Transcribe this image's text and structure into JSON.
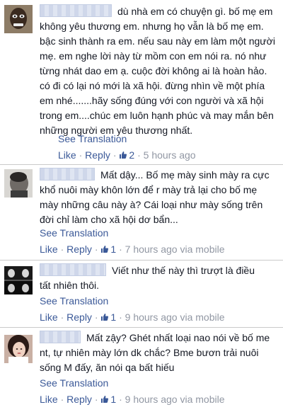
{
  "ui": {
    "see_translation": "See Translation",
    "like": "Like",
    "reply": "Reply",
    "dot": "·"
  },
  "comments": [
    {
      "text": "dù nhà em có chuyện gì. bố mẹ em không yêu thương em. nhưng họ vẫn là bố mẹ em. bậc sinh thành ra em. nếu sau này em làm một người mẹ. em nghe lời này từ mồm con em nói ra. nó như từng nhát dao em ạ. cuộc đời không ai là hoàn hảo. có đi có lại nó mới là xã hội. đừng nhìn về một phía em nhé.......hãy sống đúng với con người và xã hội trong em....chúc em luôn hạnh phúc và may mắn bên những người em yêu thương nhất.",
      "likes": "2",
      "time": "5 hours ago",
      "via": ""
    },
    {
      "text": "Mất dậy... Bố mẹ mày sinh mày ra cực khổ nuôi mày khôn lớn để r mày trả lại cho bố mẹ mày những câu này à? Cái loại như mày sống trên đời chỉ làm cho xã hội dơ bẩn...",
      "likes": "1",
      "time": "7 hours ago",
      "via": "via mobile"
    },
    {
      "text": "Viết như thế này thì trượt là điều tất nhiên thôi.",
      "likes": "1",
      "time": "9 hours ago",
      "via": "via mobile"
    },
    {
      "text": "Mất zậy? Ghét nhất loại nao nói về bố me nt, tự nhiên mày lớn dk chắc? Bme bươn trải nuôi sống M đấy, ăn nói qa bất hiếu",
      "likes": "1",
      "time": "9 hours ago",
      "via": "via mobile"
    }
  ],
  "colors": {
    "link": "#3b5998",
    "meta": "#9197a3",
    "text": "#141823",
    "divider": "#c9c9c9"
  }
}
